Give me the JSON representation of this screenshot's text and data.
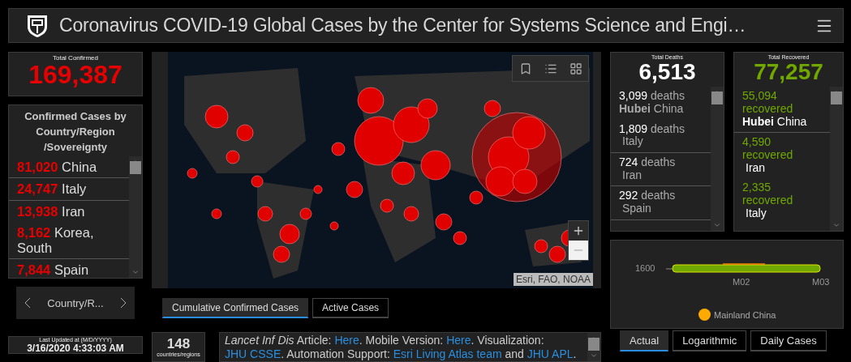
{
  "header": {
    "title": "Coronavirus COVID-19 Global Cases by the Center for Systems Science and Engi…"
  },
  "total_confirmed": {
    "label": "Total Confirmed",
    "value": "169,387"
  },
  "country_list": {
    "title": "Confirmed Cases by Country/Region /Sovereignty",
    "items": [
      {
        "count": "81,020",
        "name": "China"
      },
      {
        "count": "24,747",
        "name": "Italy"
      },
      {
        "count": "13,938",
        "name": "Iran"
      },
      {
        "count": "8,162",
        "name": "Korea, South"
      },
      {
        "count": "7,844",
        "name": "Spain"
      }
    ]
  },
  "pager": {
    "label": "Country/R..."
  },
  "last_updated": {
    "label": "Last Updated at (M/D/YYYY)",
    "value": "3/16/2020 4:33:03 AM"
  },
  "map": {
    "attribution": "Esri, FAO, NOAA",
    "tabs": [
      {
        "label": "Cumulative Confirmed Cases",
        "selected": true
      },
      {
        "label": "Active Cases",
        "selected": false
      }
    ]
  },
  "counter": {
    "value": "148",
    "label": "countries/regions"
  },
  "info": [
    {
      "kind": "italic",
      "text": "Lancet Inf Dis"
    },
    {
      "kind": "plain",
      "text": " Article: "
    },
    {
      "kind": "link",
      "text": "Here"
    },
    {
      "kind": "plain",
      "text": ". Mobile Version: "
    },
    {
      "kind": "link",
      "text": "Here"
    },
    {
      "kind": "plain",
      "text": ". Visualization: "
    },
    {
      "kind": "link",
      "text": "JHU CSSE"
    },
    {
      "kind": "plain",
      "text": ". Automation Support: "
    },
    {
      "kind": "link",
      "text": "Esri Living Atlas team"
    },
    {
      "kind": "plain",
      "text": " and "
    },
    {
      "kind": "link",
      "text": "JHU APL"
    },
    {
      "kind": "plain",
      "text": "."
    }
  ],
  "deaths": {
    "label": "Total Deaths",
    "value": "6,513",
    "items": [
      {
        "count": "3,099",
        "unit": "deaths",
        "place": "**Hubei** China"
      },
      {
        "count": "1,809",
        "unit": "deaths",
        "place": "Italy"
      },
      {
        "count": "724",
        "unit": "deaths",
        "place": "Iran"
      },
      {
        "count": "292",
        "unit": "deaths",
        "place": "Spain"
      }
    ]
  },
  "recovered": {
    "label": "Total Recovered",
    "value": "77,257",
    "items": [
      {
        "count": "55,094",
        "unit": "recovered",
        "place": "**Hubei** China"
      },
      {
        "count": "4,590",
        "unit": "recovered",
        "place": "Iran"
      },
      {
        "count": "2,335",
        "unit": "recovered",
        "place": "Italy"
      }
    ]
  },
  "chart": {
    "y_label": "1600",
    "x_labels": [
      "M02",
      "M03"
    ],
    "legend": {
      "label": "Mainland China",
      "color": "#ffaa00"
    },
    "tabs": [
      {
        "label": "Actual",
        "selected": true
      },
      {
        "label": "Logarithmic",
        "selected": false
      },
      {
        "label": "Daily Cases",
        "selected": false
      }
    ]
  }
}
